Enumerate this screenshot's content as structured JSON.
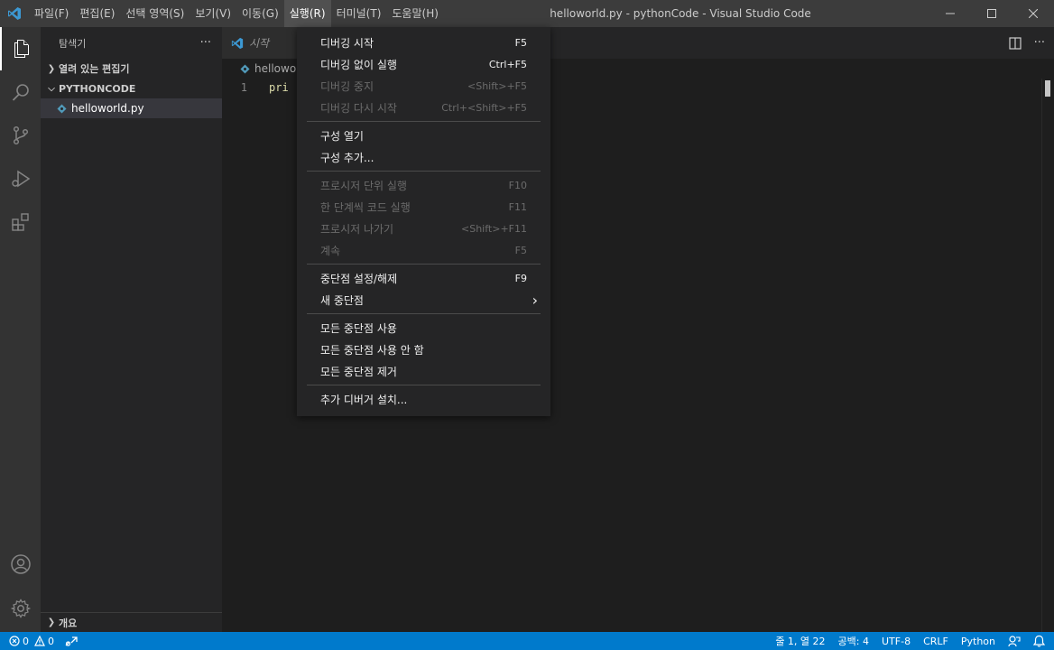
{
  "window": {
    "title": "helloworld.py - pythonCode - Visual Studio Code"
  },
  "menubar": {
    "items": [
      {
        "label": "파일(F)"
      },
      {
        "label": "편집(E)"
      },
      {
        "label": "선택 영역(S)"
      },
      {
        "label": "보기(V)"
      },
      {
        "label": "이동(G)"
      },
      {
        "label": "실행(R)"
      },
      {
        "label": "터미널(T)"
      },
      {
        "label": "도움말(H)"
      }
    ]
  },
  "run_menu": {
    "groups": [
      [
        {
          "label": "디버깅 시작",
          "shortcut": "F5",
          "enabled": true
        },
        {
          "label": "디버깅 없이 실행",
          "shortcut": "Ctrl+F5",
          "enabled": true
        },
        {
          "label": "디버깅 중지",
          "shortcut": "<Shift>+F5",
          "enabled": false
        },
        {
          "label": "디버깅 다시 시작",
          "shortcut": "Ctrl+<Shift>+F5",
          "enabled": false
        }
      ],
      [
        {
          "label": "구성 열기",
          "shortcut": "",
          "enabled": true
        },
        {
          "label": "구성 추가...",
          "shortcut": "",
          "enabled": true
        }
      ],
      [
        {
          "label": "프로시저 단위 실행",
          "shortcut": "F10",
          "enabled": false
        },
        {
          "label": "한 단계씩 코드 실행",
          "shortcut": "F11",
          "enabled": false
        },
        {
          "label": "프로시저 나가기",
          "shortcut": "<Shift>+F11",
          "enabled": false
        },
        {
          "label": "계속",
          "shortcut": "F5",
          "enabled": false
        }
      ],
      [
        {
          "label": "중단점 설정/해제",
          "shortcut": "F9",
          "enabled": true
        },
        {
          "label": "새 중단점",
          "shortcut": "›",
          "enabled": true
        }
      ],
      [
        {
          "label": "모든 중단점 사용",
          "shortcut": "",
          "enabled": true
        },
        {
          "label": "모든 중단점 사용 안 함",
          "shortcut": "",
          "enabled": true
        },
        {
          "label": "모든 중단점 제거",
          "shortcut": "",
          "enabled": true
        }
      ],
      [
        {
          "label": "추가 디버거 설치...",
          "shortcut": "",
          "enabled": true
        }
      ]
    ]
  },
  "sidebar": {
    "title": "탐색기",
    "more": "···",
    "open_editors": "열려 있는 편집기",
    "folder": "PYTHONCODE",
    "file": "helloworld.py",
    "outline": "개요"
  },
  "editor": {
    "tab_label": "시작",
    "breadcrumb": "hellowor",
    "line_number": "1",
    "code": "pri"
  },
  "statusbar": {
    "errors": "0",
    "warnings": "0",
    "position": "줄 1, 열 22",
    "spaces": "공백: 4",
    "encoding": "UTF-8",
    "eol": "CRLF",
    "language": "Python"
  },
  "colors": {
    "accent": "#007acc",
    "vscode_blue": "#3c99d4"
  }
}
